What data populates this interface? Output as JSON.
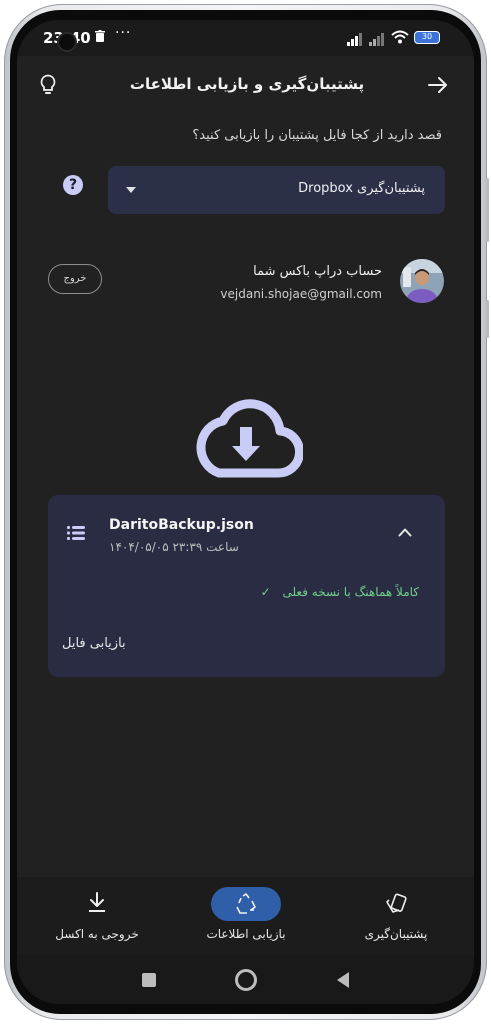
{
  "status_bar": {
    "time": "23:40",
    "battery": "30"
  },
  "header": {
    "title": "پشتیبان‌گیری و بازیابی اطلاعات",
    "left_icon": "lightbulb-icon",
    "right_icon": "arrow-forward-icon"
  },
  "question": "قصد دارید از کجا فایل پشتیبان را بازیابی کنید؟",
  "source_dropdown": {
    "selected": "پشتیبان‌گیری Dropbox"
  },
  "account": {
    "title": "حساب دراپ باکس شما",
    "email": "vejdani.shojae@gmail.com",
    "logout_label": "خروج"
  },
  "backup_card": {
    "file_name": "DaritoBackup.json",
    "date": "ساعت ۲۳:۳۹ ۱۴۰۴/۰۵/۰۵",
    "sync_status": "کاملاً هماهنگ با نسخه فعلی",
    "restore_label": "بازیابی فایل"
  },
  "bottom_nav": {
    "items": [
      {
        "label": "خروجی به اکسل",
        "icon": "download-icon"
      },
      {
        "label": "بازیابی اطلاعات",
        "icon": "recycle-icon",
        "active": true
      },
      {
        "label": "پشتیبان‌گیری",
        "icon": "backup-layers-icon"
      }
    ]
  },
  "colors": {
    "accent": "#2e5fa8",
    "card": "#2a2c44",
    "success": "#6fd08a",
    "background": "#212121"
  }
}
